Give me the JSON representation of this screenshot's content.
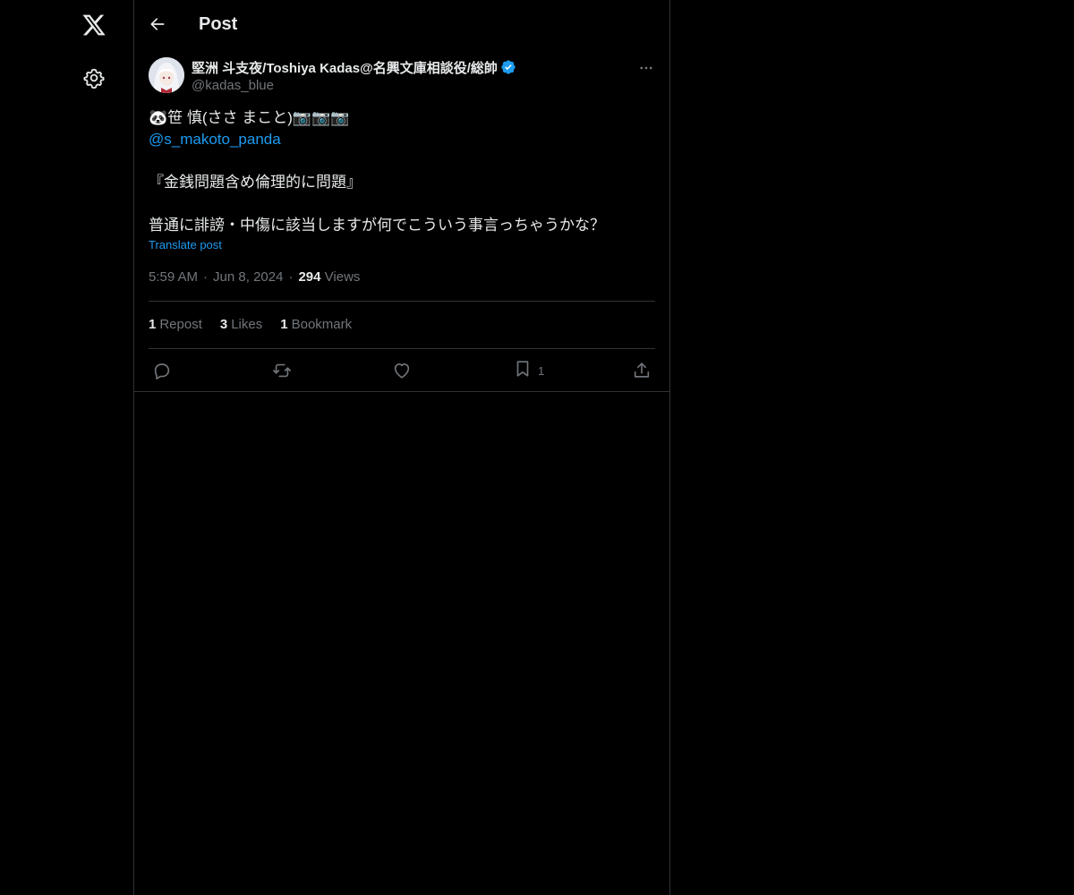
{
  "header": {
    "title": "Post"
  },
  "post": {
    "author_name": "堅洲 斗支夜/Toshiya Kadas@名興文庫相談役/総帥",
    "author_handle": "@kadas_blue",
    "lines": [
      "🐼笹 慎(ささ まこと)📷📷📷",
      "@s_makoto_panda",
      "",
      "『金銭問題含め倫理的に問題』",
      "",
      "普通に誹謗・中傷に該当しますが何でこういう事言っちゃうかな？"
    ],
    "translate_label": "Translate post",
    "time": "5:59 AM",
    "date": "Jun 8, 2024",
    "separator": "·",
    "views_count": "294",
    "views_label": "Views",
    "reposts_count": "1",
    "reposts_label": "Repost",
    "likes_count": "3",
    "likes_label": "Likes",
    "bookmarks_count": "1",
    "bookmarks_label": "Bookmark",
    "bookmark_action_count": "1"
  },
  "icons": {
    "logo": "x-logo-icon",
    "settings": "gear-icon",
    "back": "arrow-left-icon",
    "verified": "verified-badge-icon",
    "more": "more-horizontal-icon",
    "reply": "reply-icon",
    "repost": "repost-icon",
    "like": "heart-icon",
    "bookmark": "bookmark-icon",
    "share": "share-icon"
  },
  "colors": {
    "background": "#000000",
    "text": "#e7e9ea",
    "muted": "#71767b",
    "accent": "#1d9bf0",
    "border": "#2f3336"
  }
}
